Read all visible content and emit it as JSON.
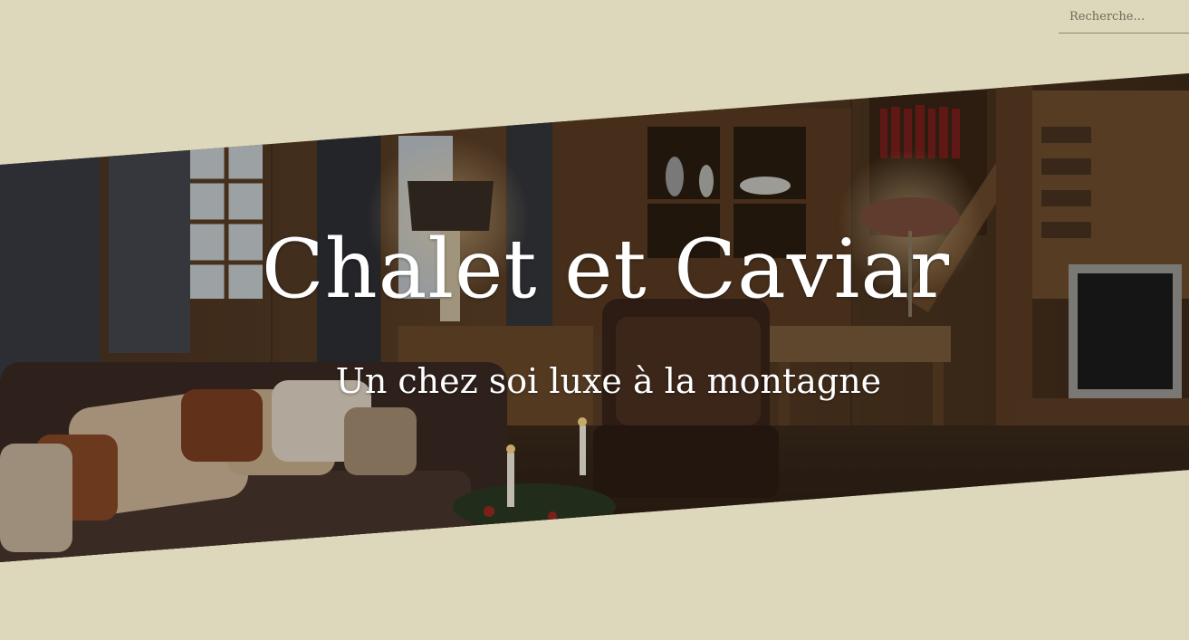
{
  "search": {
    "placeholder": "Recherche…"
  },
  "hero": {
    "title": "Chalet et Caviar",
    "subtitle": "Un chez soi luxe à la montagne",
    "image": "chalet-living-room-photo"
  },
  "colors": {
    "page_background": "#ddd8bc",
    "text_on_hero": "#ffffff",
    "search_underline": "#8a8672"
  }
}
